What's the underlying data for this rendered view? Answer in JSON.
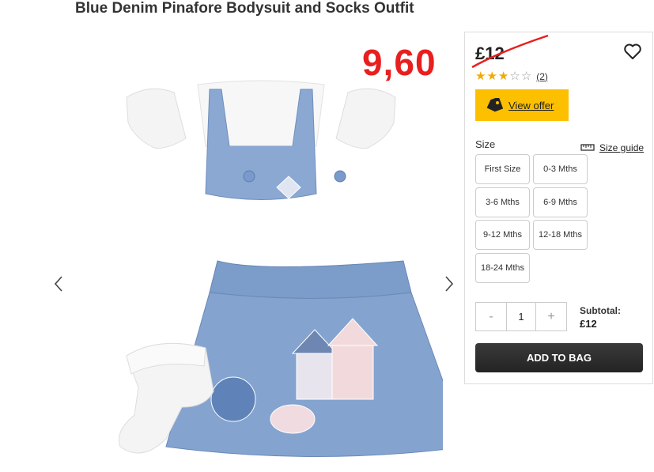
{
  "product": {
    "title": "Blue Denim Pinafore Bodysuit and Socks Outfit",
    "sale_price_annotation": "9,60",
    "old_price": "£12",
    "rating": {
      "value": 3,
      "max": 5,
      "review_count": "(2)"
    },
    "offer_label": "View offer"
  },
  "sizes": {
    "label": "Size",
    "guide_label": "Size guide",
    "options": [
      "First Size",
      "0-3 Mths",
      "3-6 Mths",
      "6-9 Mths",
      "9-12 Mths",
      "12-18 Mths",
      "18-24 Mths"
    ]
  },
  "quantity": {
    "minus": "-",
    "value": "1",
    "plus": "+"
  },
  "subtotal": {
    "label": "Subtotal:",
    "value": "£12"
  },
  "cta": {
    "add_to_bag": "ADD TO BAG"
  },
  "colors": {
    "accent_yellow": "#fdc000",
    "annotation_red": "#e81f1f",
    "star": "#f2a900",
    "button_dark": "#2b2b2b",
    "denim": "#7fa0cc"
  },
  "icons": {
    "prev": "chevron-left-icon",
    "next": "chevron-right-icon",
    "wishlist": "heart-icon",
    "offer": "tag-icon",
    "size_guide": "ruler-icon"
  }
}
